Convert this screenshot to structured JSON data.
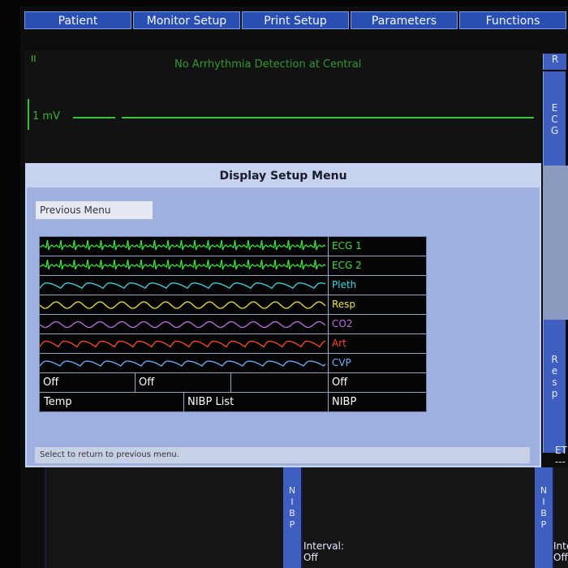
{
  "menu": [
    "Patient",
    "Monitor Setup",
    "Print Setup",
    "Parameters",
    "Functions"
  ],
  "ecg": {
    "lead": "II",
    "message": "No Arrhythmia Detection at Central",
    "scale": "1 mV"
  },
  "right_strips": {
    "top_letter": "R",
    "ecg": [
      "E",
      "C",
      "G"
    ],
    "resp": [
      "R",
      "e",
      "s",
      "p"
    ]
  },
  "dialog": {
    "title": "Display Setup Menu",
    "previous_button": "Previous Menu",
    "status": "Select to return to previous menu."
  },
  "waves": [
    {
      "label": "ECG 1",
      "color": "#37e03a",
      "kind": "ecg"
    },
    {
      "label": "ECG 2",
      "color": "#37e03a",
      "kind": "ecg"
    },
    {
      "label": "Pleth",
      "color": "#3ad6e8",
      "kind": "pleth"
    },
    {
      "label": "Resp",
      "color": "#f0e23a",
      "kind": "resp"
    },
    {
      "label": "CO2",
      "color": "#c46ce8",
      "kind": "co2"
    },
    {
      "label": "Art",
      "color": "#ff4a24",
      "kind": "art"
    },
    {
      "label": "CVP",
      "color": "#6cb2ff",
      "kind": "cvp"
    }
  ],
  "row_off": [
    "Off",
    "Off",
    "",
    "Off"
  ],
  "row_bottom": [
    "Temp",
    "NIBP List",
    "NIBP"
  ],
  "bottom": {
    "nibp": [
      "N",
      "I",
      "B",
      "P"
    ],
    "interval_label": "Interval:",
    "interval_value": "Off",
    "right_interval_label": "Inte",
    "right_interval_value": "Off",
    "et_label": "ET",
    "et_value": "---"
  }
}
